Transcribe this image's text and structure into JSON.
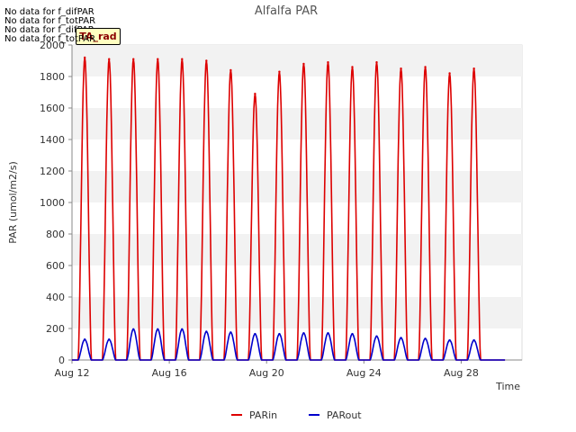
{
  "chart_data": {
    "type": "line",
    "title": "Alfalfa PAR",
    "xlabel": "Time",
    "ylabel": "PAR (umol/m2/s)",
    "ylim": [
      0,
      2000
    ],
    "yticks": [
      0,
      200,
      400,
      600,
      800,
      1000,
      1200,
      1400,
      1600,
      1800,
      2000
    ],
    "xlim_days": [
      12,
      30.5
    ],
    "xticks": [
      {
        "day": 12,
        "label": "Aug 12"
      },
      {
        "day": 16,
        "label": "Aug 16"
      },
      {
        "day": 20,
        "label": "Aug 20"
      },
      {
        "day": 24,
        "label": "Aug 24"
      },
      {
        "day": 28,
        "label": "Aug 28"
      }
    ],
    "grid": "horizontal bands",
    "legend_position": "bottom",
    "days": [
      12,
      13,
      14,
      15,
      16,
      17,
      18,
      19,
      20,
      21,
      22,
      23,
      24,
      25,
      26,
      27,
      28,
      29
    ],
    "series": [
      {
        "name": "PARin",
        "color": "#dd0000",
        "daily_peak": [
          1920,
          1910,
          1910,
          1910,
          1910,
          1900,
          1840,
          1690,
          1830,
          1880,
          1890,
          1860,
          1890,
          1850,
          1860,
          1820,
          1850,
          0
        ]
      },
      {
        "name": "PARout",
        "color": "#0000cc",
        "daily_peak": [
          130,
          130,
          195,
          195,
          195,
          180,
          175,
          165,
          165,
          170,
          170,
          165,
          150,
          140,
          135,
          125,
          125,
          0
        ]
      }
    ]
  },
  "legend": {
    "items": [
      {
        "label": "PARin",
        "color": "#dd0000"
      },
      {
        "label": "PARout",
        "color": "#0000cc"
      }
    ]
  },
  "no_data_messages": [
    "No data for f_difPAR",
    "No data for f_totPAR",
    "No data for f_difPAR",
    "No data for f_totPAR"
  ],
  "badge_text": "TA_rad"
}
